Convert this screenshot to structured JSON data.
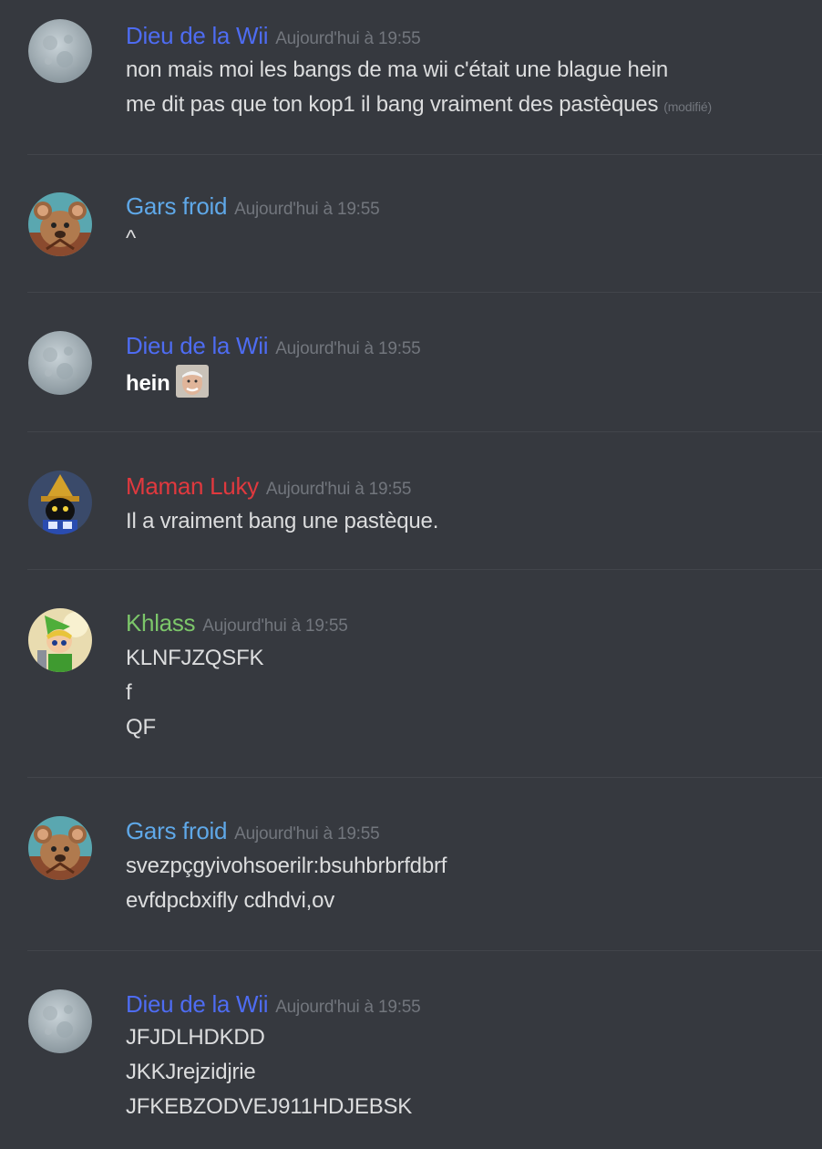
{
  "messages": [
    {
      "author": "Dieu de la Wii",
      "author_color": "#4e6cf2",
      "avatar": "moon-avatar",
      "time": "Aujourd'hui à 19:55",
      "lines": [
        "non mais moi les bangs de ma wii c'était une blague hein",
        "me dit pas que ton kop1 il bang vraiment des pastèques"
      ],
      "edited": "(modifié)"
    },
    {
      "author": "Gars froid",
      "author_color": "#5fa8e8",
      "avatar": "mouse-avatar",
      "time": "Aujourd'hui à 19:55",
      "lines": [
        "^"
      ]
    },
    {
      "author": "Dieu de la Wii",
      "author_color": "#4e6cf2",
      "avatar": "moon-avatar",
      "time": "Aujourd'hui à 19:55",
      "lines": [
        "hein"
      ],
      "emoji": "harold-emoji"
    },
    {
      "author": "Maman Luky",
      "author_color": "#e0393e",
      "avatar": "black-mage-avatar",
      "time": "Aujourd'hui à 19:55",
      "lines": [
        "Il a vraiment bang une pastèque."
      ]
    },
    {
      "author": "Khlass",
      "author_color": "#7cc66a",
      "avatar": "link-avatar",
      "time": "Aujourd'hui à 19:55",
      "lines": [
        "KLNFJZQSFK",
        "f",
        "QF"
      ]
    },
    {
      "author": "Gars froid",
      "author_color": "#5fa8e8",
      "avatar": "mouse-avatar",
      "time": "Aujourd'hui à 19:55",
      "lines": [
        "svezpçgyivohsoerilr:bsuhbrbrfdbrf",
        "evfdpcbxifly cdhdvi,ov"
      ]
    },
    {
      "author": "Dieu de la Wii",
      "author_color": "#4e6cf2",
      "avatar": "moon-avatar",
      "time": "Aujourd'hui à 19:55",
      "lines": [
        "JFJDLHDKDD",
        "JKKJrejzidjrie",
        "JFKEBZODVEJ911HDJEBSK"
      ]
    }
  ]
}
